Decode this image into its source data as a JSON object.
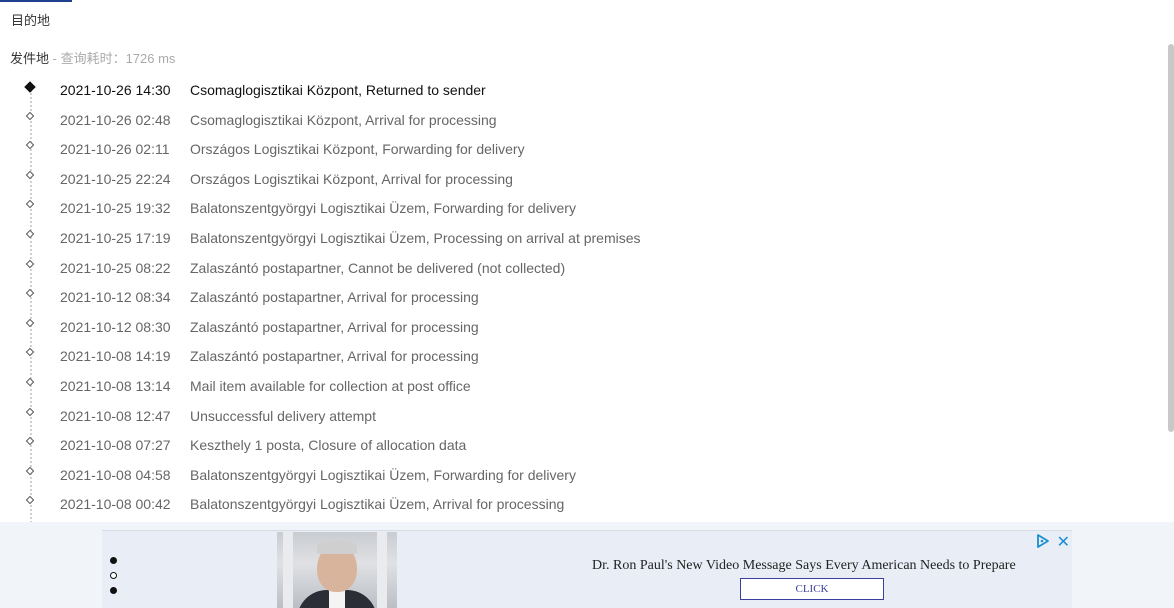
{
  "header": {
    "destination_label": "目的地",
    "origin_label": "发件地",
    "query_meta": " - 查询耗时：1726 ms"
  },
  "events": [
    {
      "time": "2021-10-26 14:30",
      "desc": "Csomaglogisztikai Központ, Returned to sender",
      "current": true
    },
    {
      "time": "2021-10-26 02:48",
      "desc": "Csomaglogisztikai Központ, Arrival for processing"
    },
    {
      "time": "2021-10-26 02:11",
      "desc": "Országos Logisztikai Központ, Forwarding for delivery"
    },
    {
      "time": "2021-10-25 22:24",
      "desc": "Országos Logisztikai Központ, Arrival for processing"
    },
    {
      "time": "2021-10-25 19:32",
      "desc": "Balatonszentgyörgyi Logisztikai Üzem, Forwarding for delivery"
    },
    {
      "time": "2021-10-25 17:19",
      "desc": "Balatonszentgyörgyi Logisztikai Üzem, Processing on arrival at premises"
    },
    {
      "time": "2021-10-25 08:22",
      "desc": "Zalaszántó postapartner, Cannot be delivered (not collected)"
    },
    {
      "time": "2021-10-12 08:34",
      "desc": "Zalaszántó postapartner, Arrival for processing"
    },
    {
      "time": "2021-10-12 08:30",
      "desc": "Zalaszántó postapartner, Arrival for processing"
    },
    {
      "time": "2021-10-08 14:19",
      "desc": "Zalaszántó postapartner, Arrival for processing"
    },
    {
      "time": "2021-10-08 13:14",
      "desc": "Mail item available for collection at post office"
    },
    {
      "time": "2021-10-08 12:47",
      "desc": "Unsuccessful delivery attempt"
    },
    {
      "time": "2021-10-08 07:27",
      "desc": "Keszthely 1 posta, Closure of allocation data"
    },
    {
      "time": "2021-10-08 04:58",
      "desc": "Balatonszentgyörgyi Logisztikai Üzem, Forwarding for delivery"
    },
    {
      "time": "2021-10-08 00:42",
      "desc": "Balatonszentgyörgyi Logisztikai Üzem, Arrival for processing"
    }
  ],
  "ad": {
    "headline": "Dr. Ron Paul's New Video Message Says Every American Needs to Prepare",
    "button_label": "CLICK",
    "close_label": "✕",
    "choices_icon": "adchoices-icon",
    "accent_color": "#1a8fd0"
  }
}
